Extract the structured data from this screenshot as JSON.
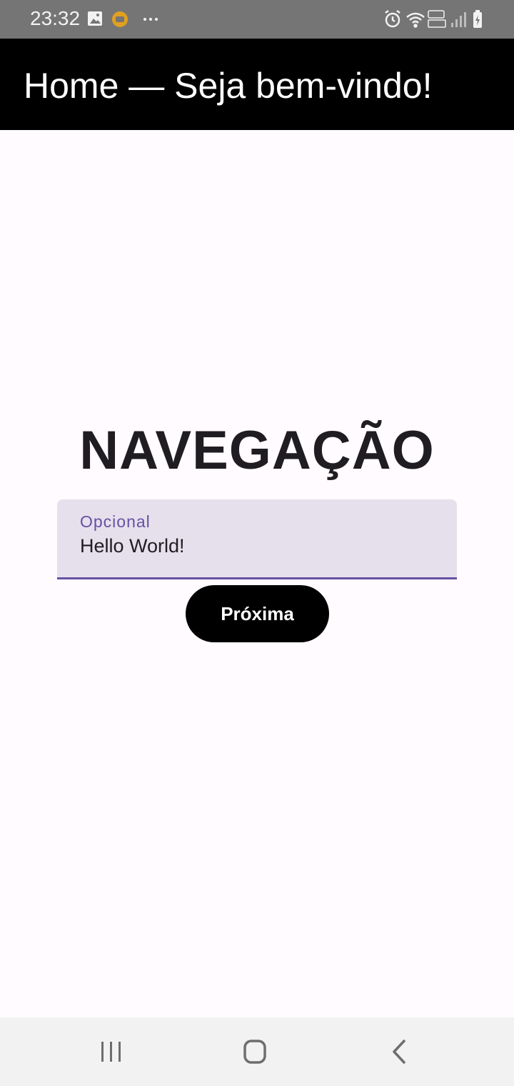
{
  "status_bar": {
    "time": "23:32",
    "left_icons": [
      "gallery-icon",
      "app-notification-icon",
      "more-dots-icon"
    ],
    "right_icons": [
      "alarm-icon",
      "wifi-icon",
      "volte-lte-icon",
      "signal-icon",
      "battery-charging-icon"
    ]
  },
  "app_bar": {
    "title": "Home — Seja bem-vindo!",
    "background": "#000000"
  },
  "main": {
    "heading": "NAVEGAÇÃO",
    "text_field": {
      "label": "Opcional",
      "value": "Hello World!"
    },
    "next_button_label": "Próxima"
  },
  "nav_bar": {
    "buttons": [
      "recents-icon",
      "home-icon",
      "back-icon"
    ]
  },
  "colors": {
    "accent": "#6750a4",
    "field_background": "#e6e0ec",
    "page_background": "#fffbfe"
  }
}
